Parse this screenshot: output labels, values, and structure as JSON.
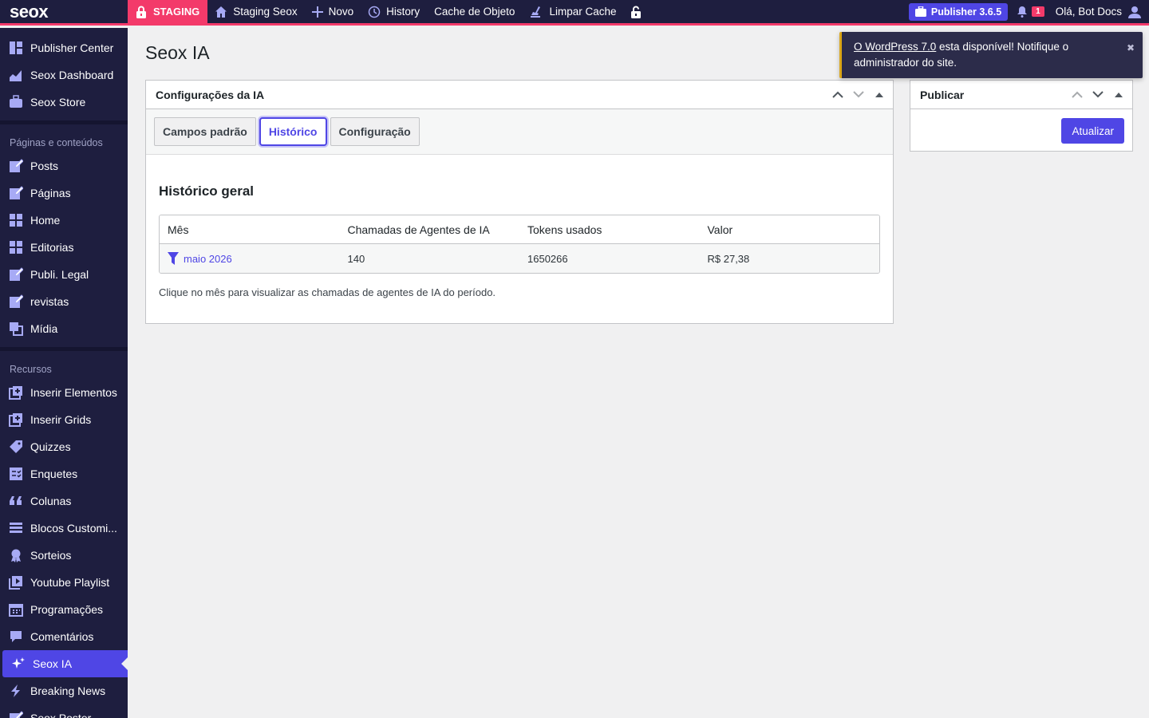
{
  "adminbar": {
    "logo": "seox",
    "staging_label": "STAGING",
    "items": [
      {
        "label": "Staging Seox",
        "icon": "home-icon"
      },
      {
        "label": "Novo",
        "icon": "plus-icon"
      },
      {
        "label": "History",
        "icon": "history-icon"
      },
      {
        "label": "Cache de Objeto",
        "icon": ""
      },
      {
        "label": "Limpar Cache",
        "icon": "broom-icon"
      }
    ],
    "publisher_badge": "Publisher 3.6.5",
    "notification_count": "1",
    "howdy": "Olá, Bot Docs"
  },
  "sidebar": {
    "top_items": [
      "Publisher Center",
      "Seox Dashboard",
      "Seox Store"
    ],
    "heading_pages": "Páginas e conteúdos",
    "pages_items": [
      "Posts",
      "Páginas",
      "Home",
      "Editorias",
      "Publi. Legal",
      "revistas",
      "Mídia"
    ],
    "heading_resources": "Recursos",
    "resources_items": [
      "Inserir Elementos",
      "Inserir Grids",
      "Quizzes",
      "Enquetes",
      "Colunas",
      "Blocos Customi...",
      "Sorteios",
      "Youtube Playlist",
      "Programações",
      "Comentários",
      "Seox IA",
      "Breaking News",
      "Seox Poster"
    ]
  },
  "page": {
    "title": "Seox IA",
    "config_box": {
      "title": "Configurações da IA",
      "tabs": [
        "Campos padrão",
        "Histórico",
        "Configuração"
      ],
      "active_tab": "Histórico",
      "section_title": "Histórico geral",
      "table": {
        "headers": [
          "Mês",
          "Chamadas de Agentes de IA",
          "Tokens usados",
          "Valor"
        ],
        "rows": [
          {
            "month": "maio 2026",
            "calls": "140",
            "tokens": "1650266",
            "value": "R$ 27,38"
          }
        ]
      },
      "hint": "Clique no mês para visualizar as chamadas de agentes de IA do período."
    },
    "publish_box": {
      "title": "Publicar",
      "button": "Atualizar"
    }
  },
  "notice": {
    "link": "O WordPress 7.0",
    "text": " esta disponível! Notifique o administrador do site.",
    "close": "✖"
  },
  "colors": {
    "accent": "#4f46e5",
    "sidebar_bg": "#1e1e3f",
    "staging": "#f33a6a"
  }
}
